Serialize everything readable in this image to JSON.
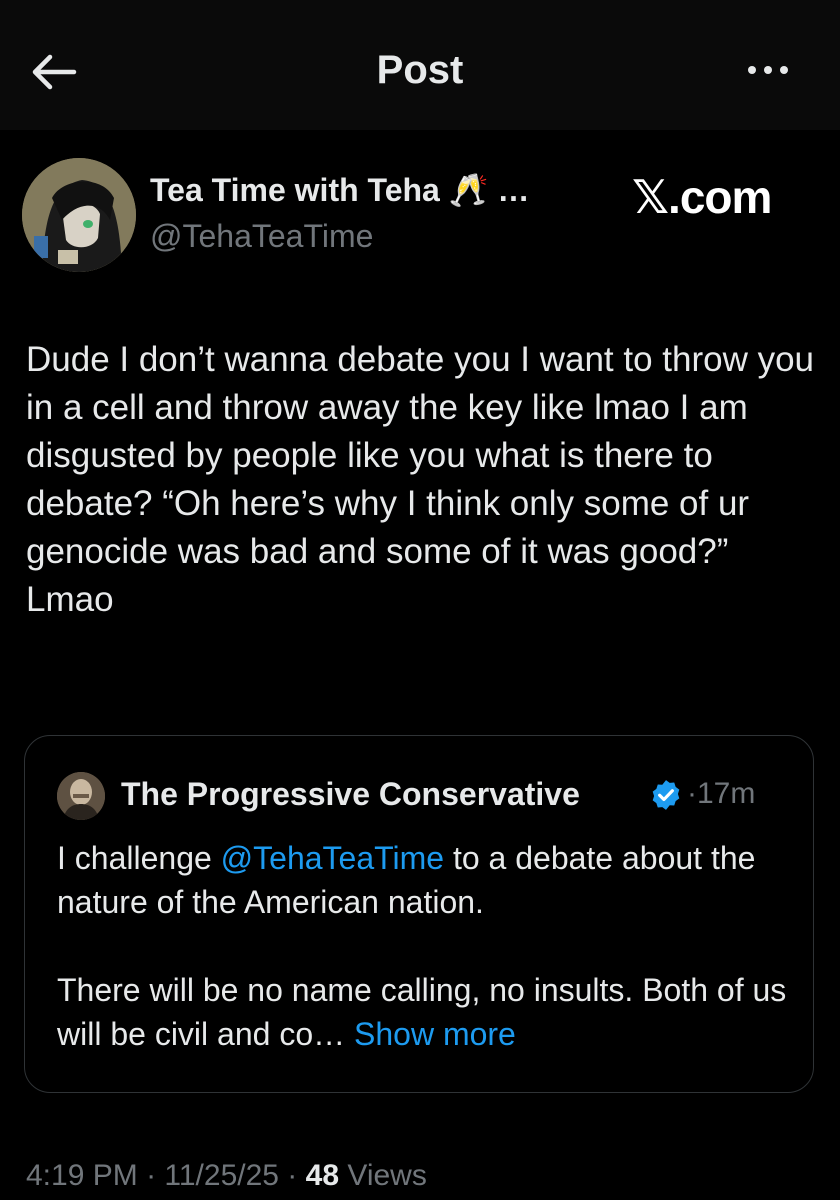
{
  "header": {
    "title": "Post",
    "back_icon": "arrow-left-icon",
    "more_icon": "more-horizontal-icon"
  },
  "post": {
    "author_name": "Tea Time with Teha 🥂 …",
    "author_handle": "@TehaTeaTime",
    "watermark": "𝕏.com",
    "text": "Dude I don’t wanna debate you I want to throw you in a cell and throw away the key like lmao I am disgusted by people like you what is there to debate? “Oh here’s why I think only some of ur genocide was bad and some of it was good?” Lmao"
  },
  "quote": {
    "author_name": "The Progressive Conservative",
    "verified_icon": "verified-badge-icon",
    "separator": "·",
    "time": "17m",
    "text_before_mention": "I challenge ",
    "mention": "@TehaTeaTime",
    "text_after_mention": " to a debate about the nature of the American nation.",
    "paragraph2": "There will be no name calling, no insults. Both of us will be civil and co…",
    "show_more": "Show more"
  },
  "meta": {
    "time": "4:19 PM",
    "sep1": " · ",
    "date": "11/25/25",
    "sep2": " · ",
    "views_count": "48",
    "views_label": " Views"
  },
  "colors": {
    "background": "#000000",
    "text": "#e7e9ea",
    "secondary": "#71767b",
    "link": "#1d9bf0",
    "border": "#2f3336"
  }
}
